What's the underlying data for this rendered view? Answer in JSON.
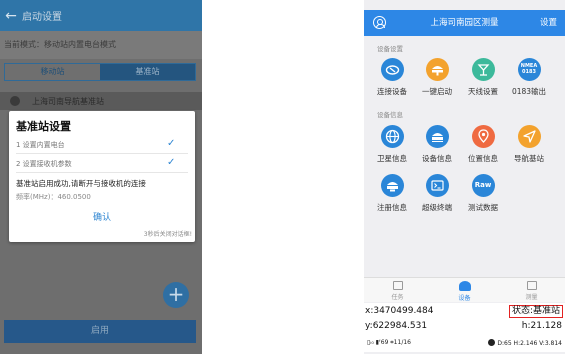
{
  "left": {
    "topbar": {
      "title": "启动设置"
    },
    "mode_text": "当前模式：移动站内置电台模式",
    "segments": [
      "移动站",
      "基准站"
    ],
    "station_name": "上海司南导航基准站",
    "dialog": {
      "title": "基准站设置",
      "steps": [
        {
          "label": "1  设置内置电台",
          "done": true
        },
        {
          "label": "2  设置接收机参数",
          "done": true
        }
      ],
      "message": "基准站启用成功,请断开与接收机的连接",
      "frequency": "频率(MHz)：460.0500",
      "confirm": "确认",
      "auto_close": "3秒后关闭对话框!"
    },
    "fab_symbol": "+",
    "enable_button": "启用"
  },
  "right": {
    "header": {
      "title": "上海司南园区测量",
      "settings": "设置"
    },
    "sections": [
      {
        "title": "设备设置",
        "items": [
          {
            "label": "连接设备",
            "icon": "link-device-icon",
            "color": "#2a86d8"
          },
          {
            "label": "一键启动",
            "icon": "one-key-start-icon",
            "color": "#f3a22d"
          },
          {
            "label": "天线设置",
            "icon": "antenna-icon",
            "color": "#3cb99b"
          },
          {
            "label": "0183输出",
            "icon": "nmea-icon",
            "color": "#2a86d8",
            "badge": [
              "NMEA",
              "0183"
            ]
          }
        ]
      },
      {
        "title": "设备信息",
        "items": [
          {
            "label": "卫星信息",
            "icon": "globe-icon",
            "color": "#2a86d8"
          },
          {
            "label": "设备信息",
            "icon": "receiver-icon",
            "color": "#2a86d8"
          },
          {
            "label": "位置信息",
            "icon": "location-pin-icon",
            "color": "#ef6a41"
          },
          {
            "label": "导航基站",
            "icon": "navigation-arrow-icon",
            "color": "#f3a22d"
          },
          {
            "label": "注册信息",
            "icon": "register-icon",
            "color": "#2a86d8"
          },
          {
            "label": "超级终端",
            "icon": "terminal-icon",
            "color": "#2a86d8"
          },
          {
            "label": "测试数据",
            "icon": "raw-data-icon",
            "color": "#2a86d8",
            "badge": [
              "Raw"
            ]
          }
        ]
      }
    ],
    "tabs": [
      {
        "label": "任务",
        "active": false
      },
      {
        "label": "设备",
        "active": true
      },
      {
        "label": "测量",
        "active": false
      }
    ],
    "coords": {
      "x": "x:3470499.484",
      "y": "y:622984.531",
      "status": "状态:基准站",
      "h": "h:21.128"
    },
    "statusbar": {
      "left": "▯ᵢ₀ ▮ᶠ69 ⌗11/16",
      "right": "D:65 H:2.146 V:3.814"
    }
  }
}
